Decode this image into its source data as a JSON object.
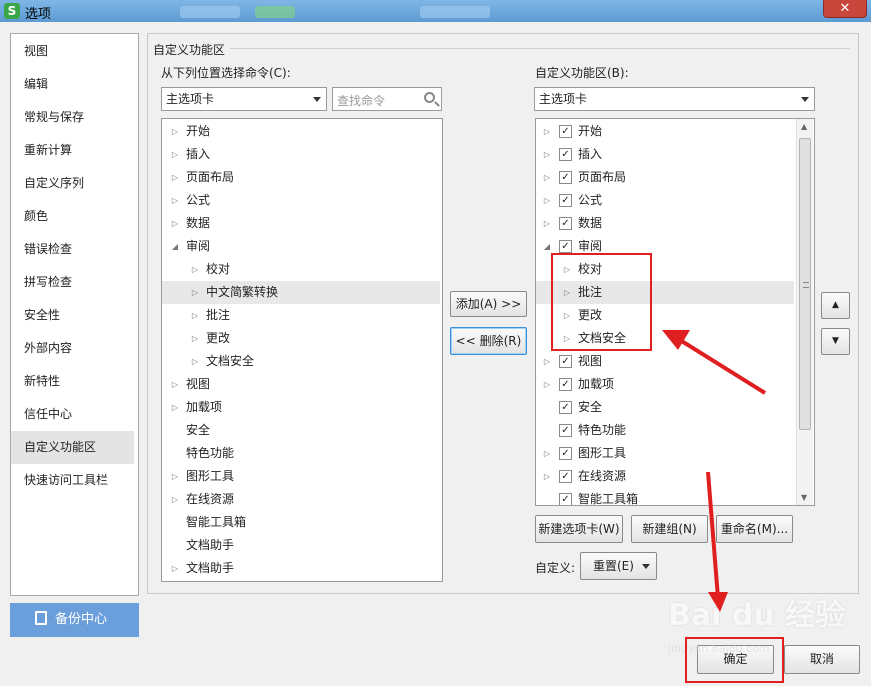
{
  "window": {
    "title": "选项",
    "app_icon": "S",
    "close_glyph": "✕"
  },
  "nav": {
    "items": [
      "视图",
      "编辑",
      "常规与保存",
      "重新计算",
      "自定义序列",
      "颜色",
      "错误检查",
      "拼写检查",
      "安全性",
      "外部内容",
      "新特性",
      "信任中心",
      "自定义功能区",
      "快速访问工具栏"
    ],
    "selected": "自定义功能区"
  },
  "backup": {
    "label": "备份中心"
  },
  "group": {
    "title": "自定义功能区"
  },
  "left": {
    "label": "从下列位置选择命令(C):",
    "combo": "主选项卡",
    "search_placeholder": "查找命令",
    "items": [
      {
        "text": "开始",
        "level": 0,
        "tri": "▷"
      },
      {
        "text": "插入",
        "level": 0,
        "tri": "▷"
      },
      {
        "text": "页面布局",
        "level": 0,
        "tri": "▷"
      },
      {
        "text": "公式",
        "level": 0,
        "tri": "▷"
      },
      {
        "text": "数据",
        "level": 0,
        "tri": "▷"
      },
      {
        "text": "审阅",
        "level": 0,
        "tri": "◢"
      },
      {
        "text": "校对",
        "level": 1,
        "tri": "▷"
      },
      {
        "text": "中文简繁转换",
        "level": 1,
        "tri": "▷",
        "selected": true
      },
      {
        "text": "批注",
        "level": 1,
        "tri": "▷"
      },
      {
        "text": "更改",
        "level": 1,
        "tri": "▷"
      },
      {
        "text": "文档安全",
        "level": 1,
        "tri": "▷"
      },
      {
        "text": "视图",
        "level": 0,
        "tri": "▷"
      },
      {
        "text": "加载项",
        "level": 0,
        "tri": "▷"
      },
      {
        "text": "安全",
        "level": 0,
        "tri": ""
      },
      {
        "text": "特色功能",
        "level": 0,
        "tri": ""
      },
      {
        "text": "图形工具",
        "level": 0,
        "tri": "▷"
      },
      {
        "text": "在线资源",
        "level": 0,
        "tri": "▷"
      },
      {
        "text": "智能工具箱",
        "level": 0,
        "tri": ""
      },
      {
        "text": "文档助手",
        "level": 0,
        "tri": ""
      },
      {
        "text": "文档助手",
        "level": 0,
        "tri": "▷"
      }
    ]
  },
  "middle": {
    "add": "添加(A) >>",
    "remove": "<< 删除(R)"
  },
  "right": {
    "label": "自定义功能区(B):",
    "combo": "主选项卡",
    "items": [
      {
        "text": "开始",
        "level": 0,
        "tri": "▷",
        "checked": true
      },
      {
        "text": "插入",
        "level": 0,
        "tri": "▷",
        "checked": true
      },
      {
        "text": "页面布局",
        "level": 0,
        "tri": "▷",
        "checked": true
      },
      {
        "text": "公式",
        "level": 0,
        "tri": "▷",
        "checked": true
      },
      {
        "text": "数据",
        "level": 0,
        "tri": "▷",
        "checked": true
      },
      {
        "text": "审阅",
        "level": 0,
        "tri": "◢",
        "checked": true
      },
      {
        "text": "校对",
        "level": 1,
        "tri": "▷"
      },
      {
        "text": "批注",
        "level": 1,
        "tri": "▷",
        "selected": true
      },
      {
        "text": "更改",
        "level": 1,
        "tri": "▷"
      },
      {
        "text": "文档安全",
        "level": 1,
        "tri": "▷"
      },
      {
        "text": "视图",
        "level": 0,
        "tri": "▷",
        "checked": true
      },
      {
        "text": "加载项",
        "level": 0,
        "tri": "▷",
        "checked": true
      },
      {
        "text": "安全",
        "level": 0,
        "tri": "",
        "checked": true
      },
      {
        "text": "特色功能",
        "level": 0,
        "tri": "",
        "checked": true
      },
      {
        "text": "图形工具",
        "level": 0,
        "tri": "▷",
        "checked": true
      },
      {
        "text": "在线资源",
        "level": 0,
        "tri": "▷",
        "checked": true
      },
      {
        "text": "智能工具箱",
        "level": 0,
        "tri": "",
        "checked": true
      }
    ],
    "new_tab": "新建选项卡(W)",
    "new_group": "新建组(N)",
    "rename": "重命名(M)...",
    "custom_label": "自定义:",
    "reset": "重置(E)"
  },
  "move": {
    "up": "▲",
    "down": "▼"
  },
  "footer": {
    "ok": "确定",
    "cancel": "取消"
  },
  "watermark": {
    "brand": "Bai du 经验",
    "url": "jingyan.baidu.com"
  }
}
